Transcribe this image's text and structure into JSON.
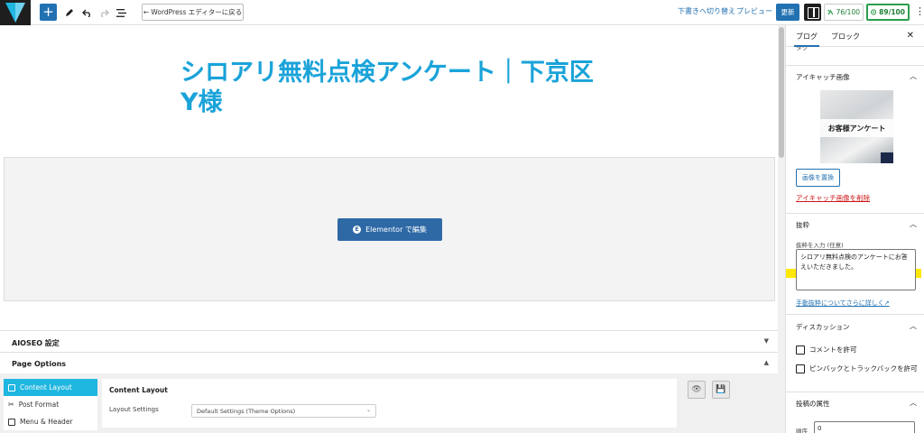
{
  "toolbar": {
    "back_to_wp_label": "← WordPress エディターに戻る",
    "switch_to_draft_label": "下書きへ切り替え",
    "preview_label": "プレビュー",
    "update_label": "更新",
    "seo_score": "76/100",
    "content_score": "89/100"
  },
  "editor": {
    "post_title": "シロアリ無料点検アンケート｜下京区Y様",
    "elementor_button_label": "Elementor で編集",
    "aioseo_label": "AIOSEO 設定",
    "page_options_label": "Page Options"
  },
  "page_options": {
    "tabs": [
      "Content Layout",
      "Post Format",
      "Menu & Header"
    ],
    "active_tab": "Content Layout",
    "content_heading": "Content Layout",
    "layout_settings_label": "Layout Settings",
    "layout_settings_value": "Default Settings (Theme Options)"
  },
  "sidebar": {
    "tab_post": "ブログ",
    "tab_block": "ブロック",
    "tags_cut_label": "タグ",
    "featured_image": {
      "heading": "アイキャッチ画像",
      "image_caption": "お客様アンケート",
      "replace_label": "画像を置換",
      "remove_label": "アイキャッチ画像を削除"
    },
    "excerpt": {
      "heading": "抜粋",
      "input_label": "抜粋を入力 (任意)",
      "value": "シロアリ無料点検のアンケートにお答えいただきました。",
      "help_link": "手動抜粋についてさらに詳しく↗"
    },
    "discussion": {
      "heading": "ディスカッション",
      "allow_comments": "コメントを許可",
      "allow_pingbacks": "ピンバックとトラックバックを許可"
    },
    "attributes": {
      "heading": "投稿の属性",
      "order_label": "順序",
      "order_value": "0"
    }
  },
  "colors": {
    "accent": "#2271b1",
    "title": "#1aa3d9",
    "elementor": "#2e69a6",
    "highlight": "#ffe800"
  }
}
